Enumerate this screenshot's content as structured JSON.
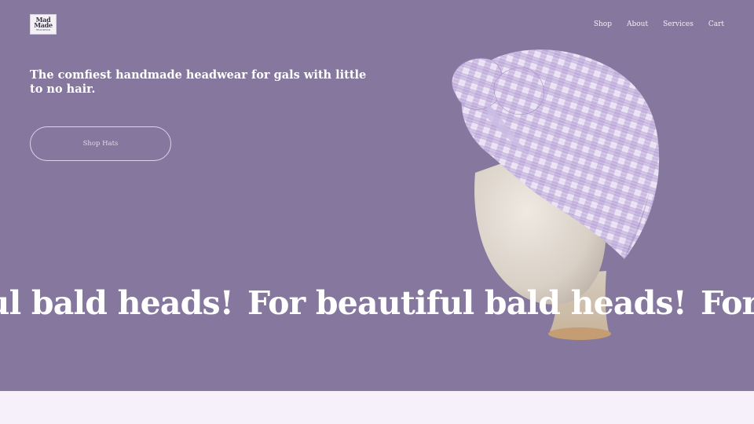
{
  "brand": {
    "logo_line1": "Mad",
    "logo_line2": "Made",
    "logo_line3": "HEADWEAR"
  },
  "nav": {
    "items": [
      "Shop",
      "About",
      "Services",
      "Cart"
    ]
  },
  "hero": {
    "headline": "The comfiest handmade headwear for gals with little to no hair.",
    "cta_label": "Shop Hats",
    "marquee_text": "For beautiful bald heads!"
  },
  "image": {
    "subject": "lilac gingham turban on mannequin head",
    "icon": "hat-photo"
  },
  "colors": {
    "hero_bg": "#85779d",
    "page_bg": "#f6f0fb",
    "text": "#ffffff"
  }
}
